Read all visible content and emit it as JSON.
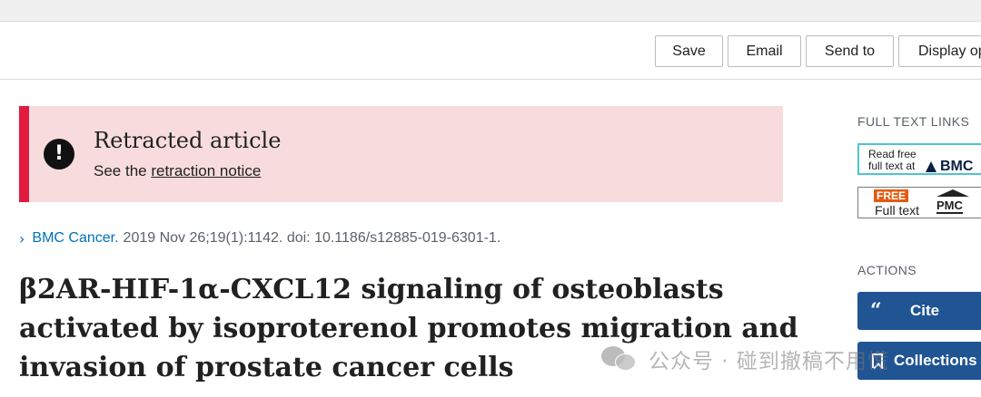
{
  "toolbar": {
    "save_label": "Save",
    "email_label": "Email",
    "send_label": "Send to",
    "display_label": "Display options"
  },
  "retraction": {
    "title": "Retracted article",
    "notice_prefix": "See the ",
    "notice_link": "retraction notice",
    "icon": "exclamation-icon",
    "accent_color": "#e11b3f",
    "background_color": "#f8dcdd"
  },
  "citation": {
    "journal": "BMC Cancer.",
    "details": "2019 Nov 26;19(1):1142. doi: 10.1186/s12885-019-6301-1."
  },
  "article": {
    "title_lines": [
      "β2AR-HIF-1α-CXCL12 signaling of osteoblasts",
      "activated by isoproterenol promotes migration and",
      "invasion of prostate cancer cells"
    ]
  },
  "sidebar": {
    "full_text_heading": "FULL TEXT LINKS",
    "bmc_read_line1": "Read free",
    "bmc_read_line2": "full text at",
    "bmc_logo": "BMC",
    "pmc_free": "FREE",
    "pmc_full_text": "Full text",
    "pmc_logo": "PMC",
    "actions_heading": "ACTIONS",
    "cite_icon": "“",
    "cite_label": "Cite",
    "collections_label": "Collections",
    "button_color": "#205493"
  },
  "watermark": {
    "text": "公众号 · 碰到撤稿不用慌"
  }
}
